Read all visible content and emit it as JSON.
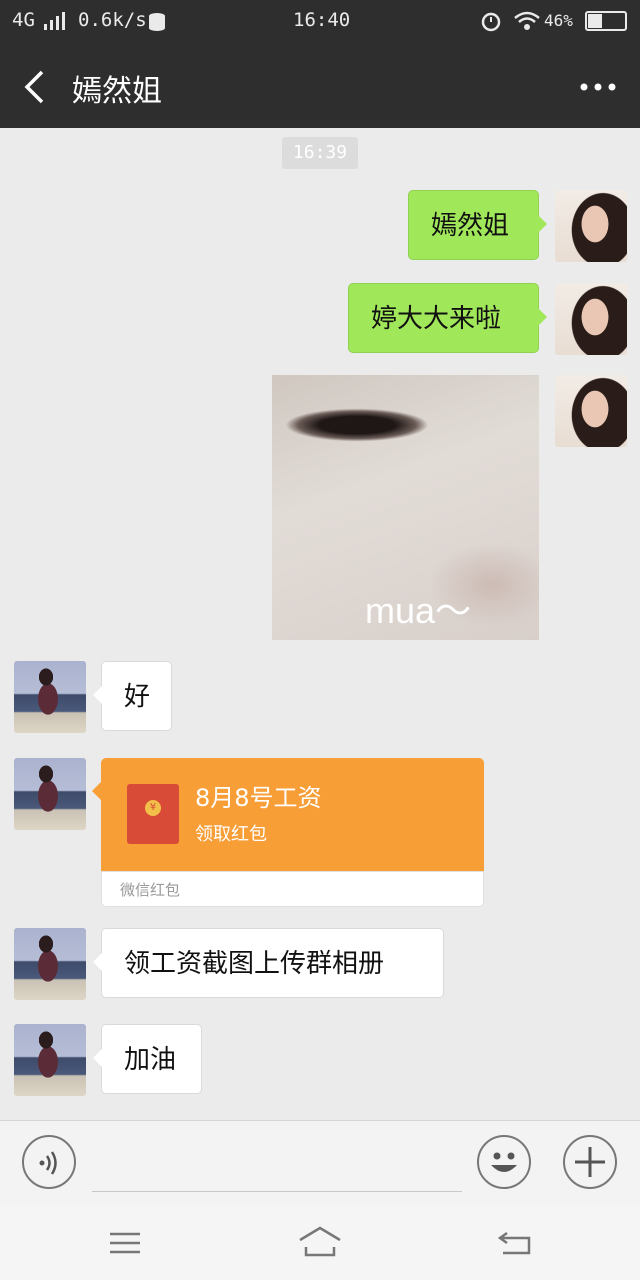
{
  "status_bar": {
    "network": "4G",
    "speed": "0.6k/s",
    "time": "16:40",
    "battery": "46%",
    "icons": [
      "signal-icon",
      "data-icon",
      "alarm-icon",
      "wifi-icon",
      "battery-icon"
    ]
  },
  "header": {
    "title": "嫣然姐",
    "back_icon": "back-icon",
    "more_icon": "more-icon"
  },
  "chat": {
    "timestamp": "16:39",
    "sent": [
      {
        "text": "嫣然姐"
      },
      {
        "text": "婷大大来啦"
      }
    ],
    "sticker_caption": "mua～",
    "received": [
      {
        "text": "好"
      },
      {
        "text": "领工资截图上传群相册"
      },
      {
        "text": "加油"
      }
    ],
    "red_packet": {
      "title": "8月8号工资",
      "subtitle": "领取红包",
      "footer": "微信红包"
    }
  },
  "colors": {
    "header_bg": "#2e2e2e",
    "sent_bubble": "#a0e75a",
    "received_bubble": "#ffffff",
    "red_packet": "#f79e37"
  }
}
